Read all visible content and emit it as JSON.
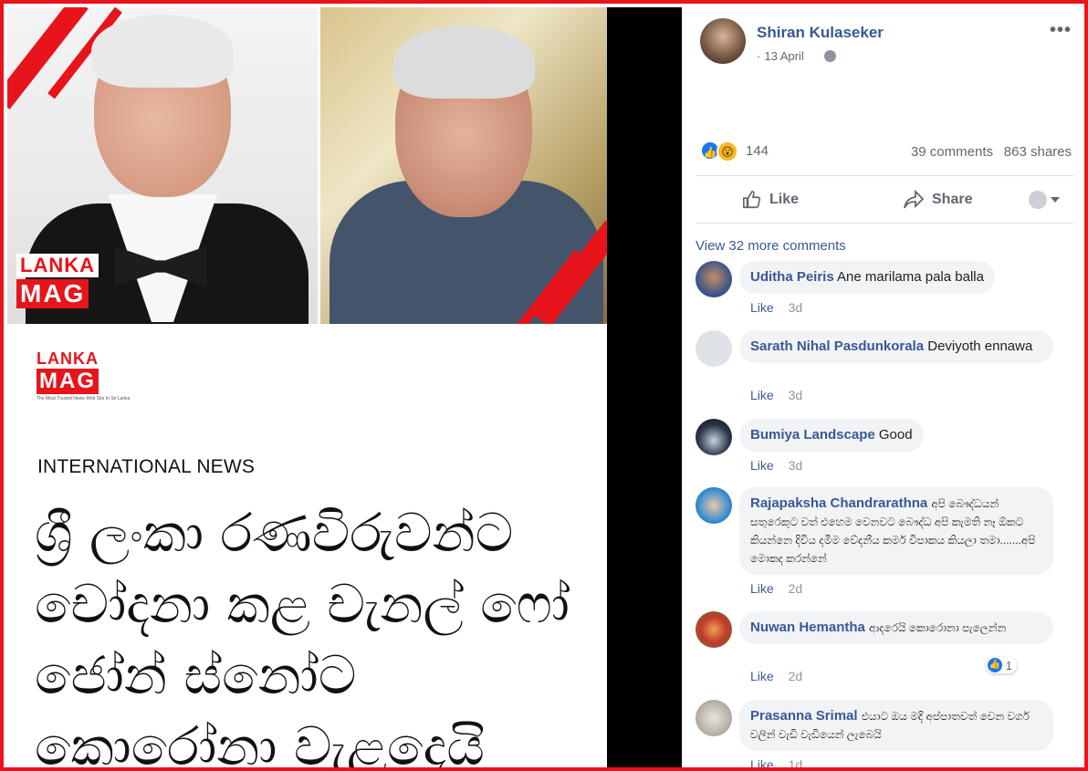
{
  "post_image": {
    "logo_top": "LANKA",
    "logo_bottom": "MAG",
    "logo_small_top": "LANKA",
    "logo_small_bottom": "MAG",
    "logo_small_tagline": "The Most Trusted News Web Site In Sri Lanka",
    "category": "INTERNATIONAL NEWS",
    "headline": "ශ්‍රී ලංකා රණවිරුවන්ට චෝදනා කළ චැනල් ෆෝ ජෝන් ස්නෝට කොරෝනා වැළදෙයි"
  },
  "post": {
    "author": "Shiran Kulaseker",
    "date": "13 April",
    "more": "•••",
    "reaction_count": "144",
    "comments_count": "39 comments",
    "shares_count": "863 shares",
    "like_label": "Like",
    "share_label": "Share",
    "view_more": "View 32 more comments"
  },
  "comments": [
    {
      "name": "Uditha Peiris",
      "text": "Ane marilama pala balla",
      "like": "Like",
      "time": "3d"
    },
    {
      "name": "Sarath Nihal Pasdunkorala",
      "text": "Deviyoth ennawa",
      "like": "Like",
      "time": "3d"
    },
    {
      "name": "Bumiya Landscape",
      "text": "Good",
      "like": "Like",
      "time": "3d"
    },
    {
      "name": "Rajapaksha Chandrarathna",
      "text": "අපි බෞද්ධයන් සතුරෙකුට වත් එහෙම වෙනවට බෞද්ධ අපි කැමති නෑ ඕකට කියන්නෙ දිවිය දමීම වේදනීය කර්ම විපාකය කියලා තමා.......අපි මොකද කරන්නේ",
      "like": "Like",
      "time": "2d"
    },
    {
      "name": "Nuwan Hemantha",
      "text": "ආදරෙයි කොරොනා පැලෙන්න",
      "like": "Like",
      "time": "2d",
      "reaction_count": "1"
    },
    {
      "name": "Prasanna Srimal",
      "text": "එයාට ඔය මදි අප්පාතවත් වෙන වර්ග වලින් වැඩි වැඩියෙන් ලැබෙයි",
      "like": "Like",
      "time": "1d"
    }
  ],
  "colors": {
    "frame": "#e8141c",
    "link": "#385898",
    "muted": "#606770",
    "bubble": "#f2f3f5"
  }
}
